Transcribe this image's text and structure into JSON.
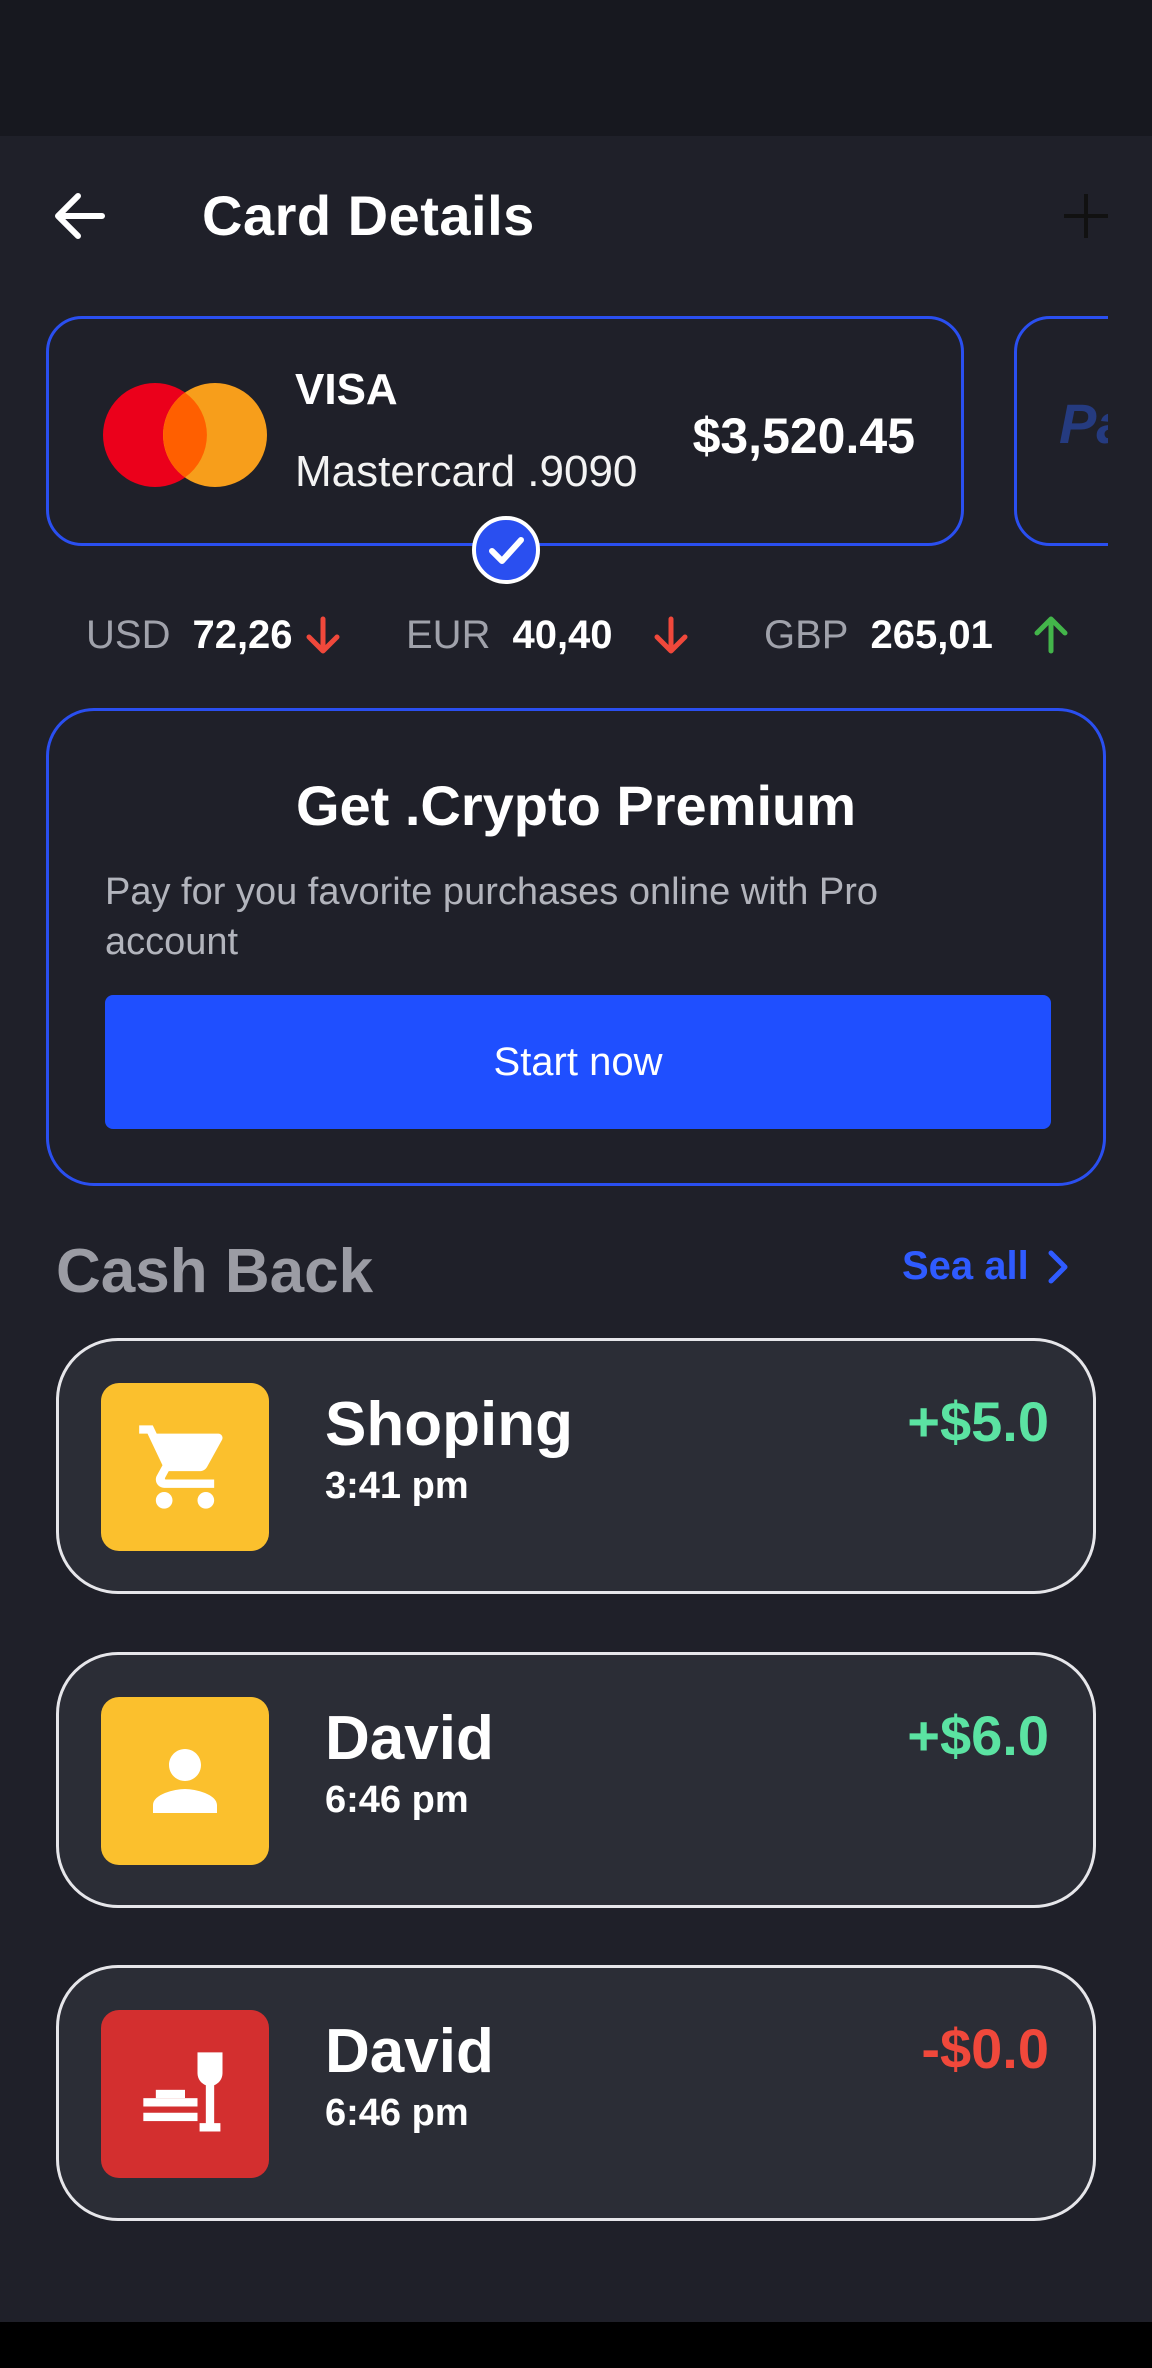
{
  "header": {
    "title": "Card Details"
  },
  "card": {
    "brand": "VISA",
    "number": "Mastercard .9090",
    "balance": "$3,520.45"
  },
  "rates": [
    {
      "code": "USD",
      "value": "72,26",
      "trend": "down"
    },
    {
      "code": "EUR",
      "value": "40,40",
      "trend": "down"
    },
    {
      "code": "GBP",
      "value": "265,01",
      "trend": "up"
    }
  ],
  "promo": {
    "title": "Get .Crypto Premium",
    "text": "Pay for you favorite purchases online with Pro account",
    "button_label": "Start now"
  },
  "cashback": {
    "title": "Cash Back",
    "see_all": "Sea all",
    "items": [
      {
        "name": "Shoping",
        "time": "3:41 pm",
        "amount": "+$5.0",
        "icon": "cart-icon",
        "icon_color": "#fbc02d"
      },
      {
        "name": "David",
        "time": "6:46 pm",
        "amount": "+$6.0",
        "icon": "person-icon",
        "icon_color": "#fbc02d"
      },
      {
        "name": "David",
        "time": "6:46 pm",
        "amount": "-$0.0",
        "icon": "restaurant-icon",
        "icon_color": "#d32f2f"
      }
    ]
  },
  "colors": {
    "accent": "#2a4ff0",
    "positive": "#5be3a2",
    "negative": "#f0483b",
    "rate_down": "#f0483b",
    "rate_up": "#43b54a"
  }
}
